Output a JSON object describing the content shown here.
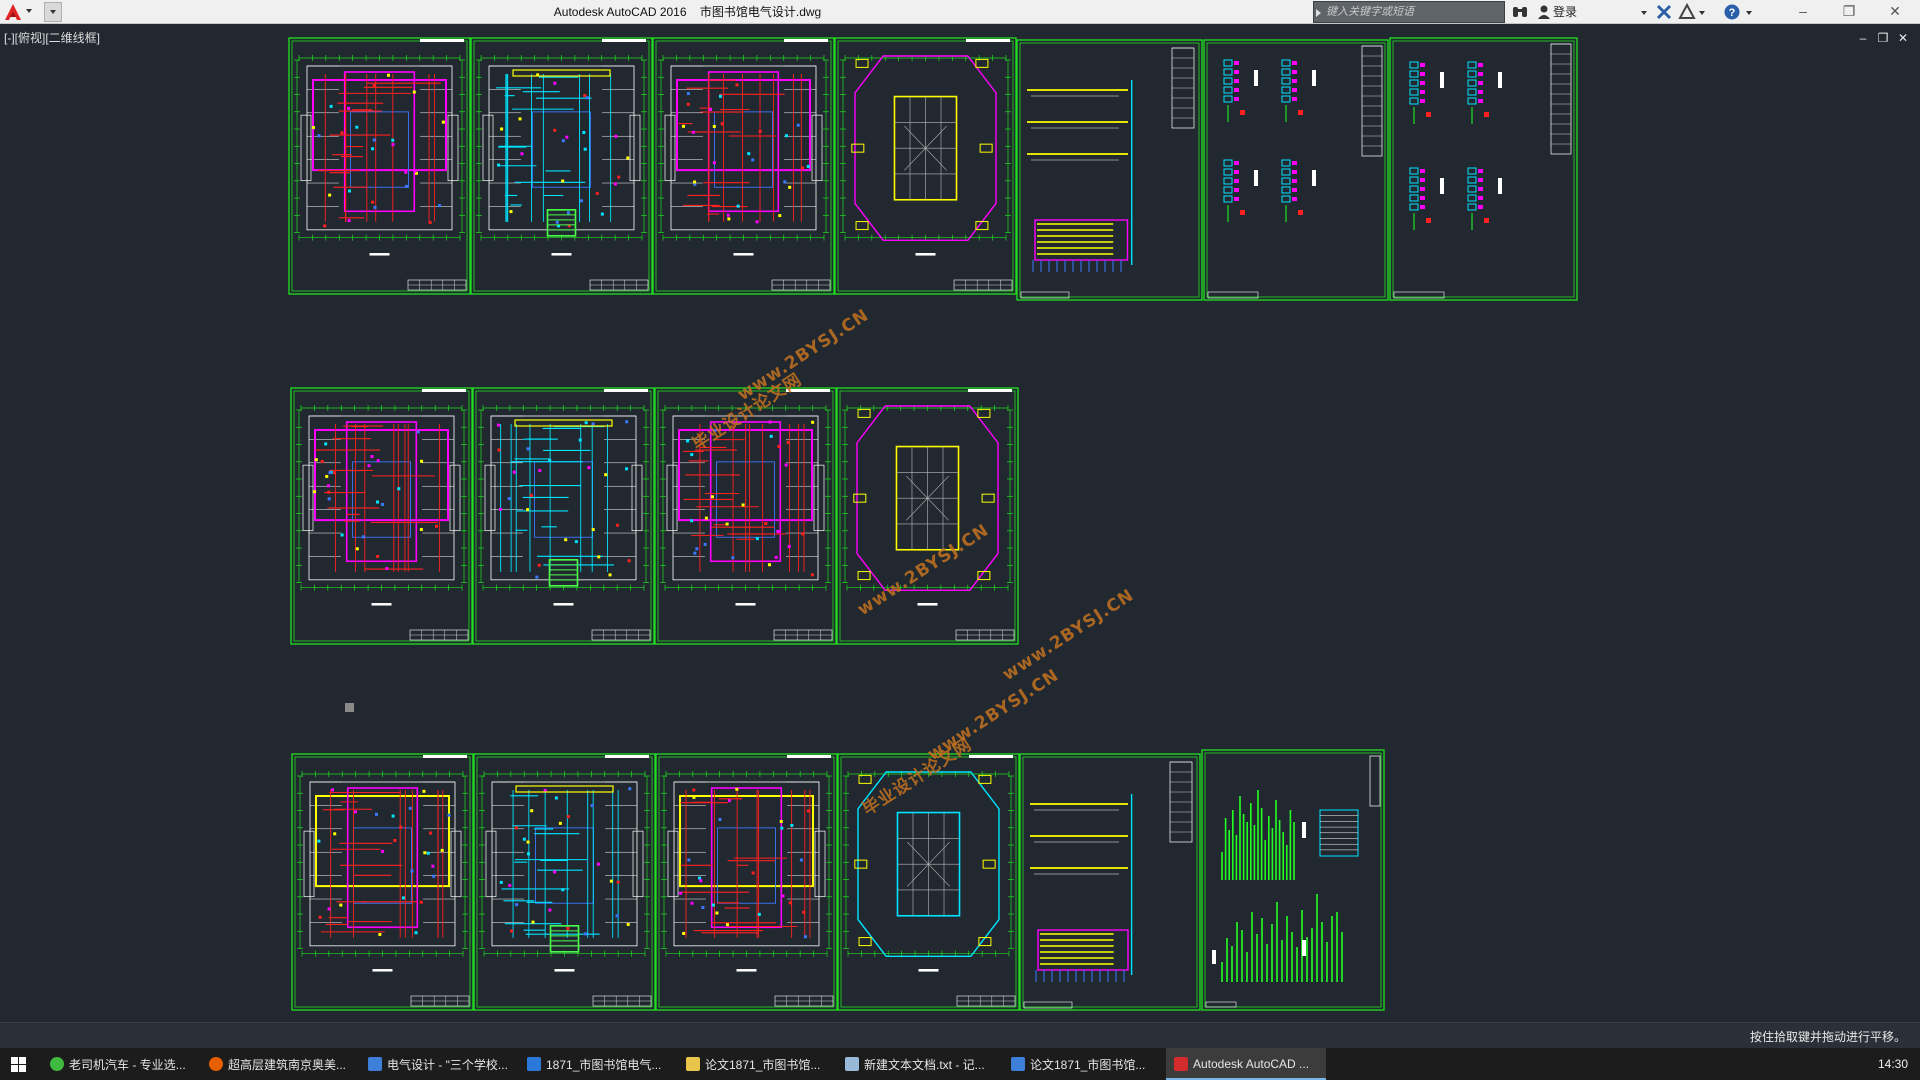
{
  "titlebar": {
    "app_name": "Autodesk AutoCAD 2016",
    "file_name": "市图书馆电气设计.dwg",
    "search_placeholder": "键入关键字或短语",
    "signin_label": "登录",
    "icons": [
      "autocad-logo",
      "binoculars-icon",
      "user-icon",
      "exchange-x-icon",
      "autodesk-a360-icon",
      "help-icon"
    ]
  },
  "viewport": {
    "label": "[-][俯视][二维线框]",
    "controls": [
      "minimize",
      "restore",
      "close"
    ]
  },
  "drawing": {
    "sheet_colors": {
      "border": "#1fe01f",
      "magenta": "#ff00ff",
      "red": "#ff2020",
      "cyan": "#00e5ff",
      "yellow": "#ffff00",
      "blue": "#3a78ff",
      "white": "#ffffff"
    },
    "watermark_texts": [
      "毕业设计论文网",
      "www.2BYSJ.CN"
    ]
  },
  "statusbar": {
    "message": "按住拾取键并拖动进行平移。"
  },
  "taskbar": {
    "items": [
      {
        "label": "老司机汽车 - 专业选...",
        "icon": "chrome-icon",
        "color": "#3fba3f"
      },
      {
        "label": "超高层建筑南京奥美...",
        "icon": "firefox-icon",
        "color": "#e66000"
      },
      {
        "label": "电气设计 - \"三个学校...",
        "icon": "word-icon",
        "color": "#3d7fd9"
      },
      {
        "label": "1871_市图书馆电气...",
        "icon": "folder-icon",
        "color": "#2a78d8"
      },
      {
        "label": "论文1871_市图书馆...",
        "icon": "folder-icon",
        "color": "#e8c54a"
      },
      {
        "label": "新建文本文档.txt - 记...",
        "icon": "notepad-icon",
        "color": "#9ab8d8"
      },
      {
        "label": "论文1871_市图书馆...",
        "icon": "word-icon",
        "color": "#3d7fd9"
      },
      {
        "label": "Autodesk AutoCAD ...",
        "icon": "autocad-icon",
        "color": "#d22c2c"
      }
    ],
    "clock": "14:30"
  }
}
